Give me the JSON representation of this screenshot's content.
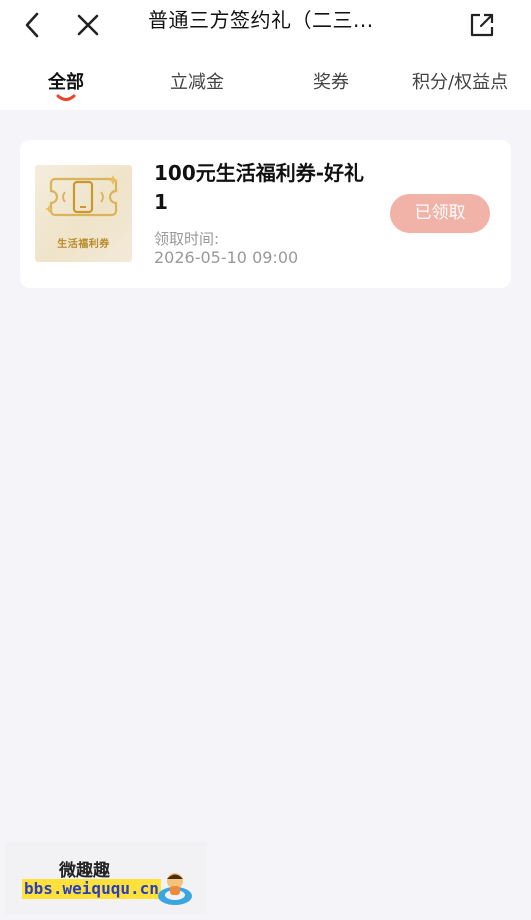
{
  "header": {
    "back_icon": "chevron-left-icon",
    "close_icon": "close-icon",
    "title": "普通三方签约礼（二三...",
    "share_icon": "share-external-icon"
  },
  "tabs": [
    {
      "label": "全部",
      "active": true
    },
    {
      "label": "立减金",
      "active": false
    },
    {
      "label": "奖券",
      "active": false
    },
    {
      "label": "积分/权益点",
      "active": false
    }
  ],
  "coupon": {
    "thumb_label": "生活福利券",
    "title": "100元生活福利券-好礼1",
    "claim_label": "领取时间:",
    "claim_time": "2026-05-10 09:00",
    "button_label": "已领取"
  },
  "watermark": {
    "title": "微趣趣",
    "url": "bbs.weiququ.cn"
  },
  "colors": {
    "background": "#f5f5f9",
    "accent": "#e8452c",
    "claimed_button": "#f1b2a8"
  }
}
